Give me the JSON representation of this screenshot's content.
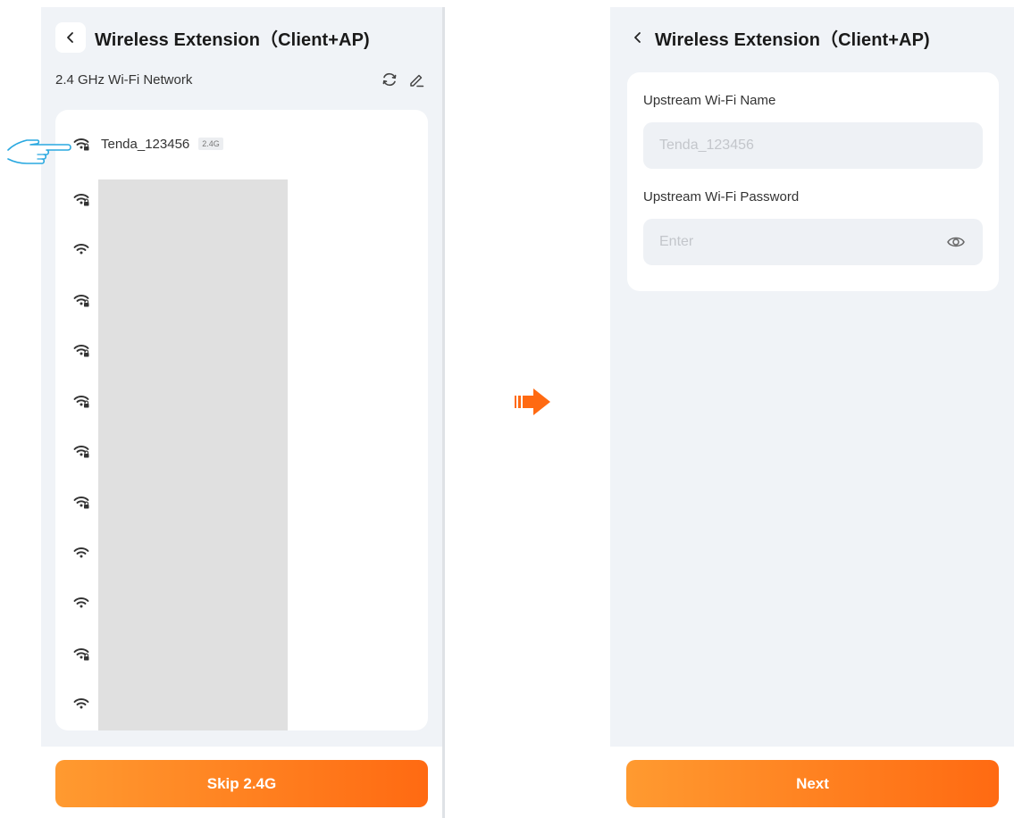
{
  "left_screen": {
    "header": {
      "title": "Wireless Extension（Client+AP)"
    },
    "section_label": "2.4 GHz Wi-Fi Network",
    "networks": [
      {
        "name": "Tenda_123456",
        "band": "2.4G",
        "icon": "wifi-lock-icon"
      },
      {
        "icon": "wifi-lock-icon"
      },
      {
        "icon": "wifi-icon"
      },
      {
        "icon": "wifi-lock-icon"
      },
      {
        "icon": "wifi-lock-icon"
      },
      {
        "icon": "wifi-lock-icon"
      },
      {
        "icon": "wifi-lock-icon"
      },
      {
        "icon": "wifi-lock-icon"
      },
      {
        "icon": "wifi-icon"
      },
      {
        "icon": "wifi-icon"
      },
      {
        "icon": "wifi-lock-icon"
      },
      {
        "icon": "wifi-icon"
      }
    ],
    "skip_button_label": "Skip 2.4G"
  },
  "right_screen": {
    "header": {
      "title": "Wireless Extension（Client+AP)"
    },
    "upstream_name_label": "Upstream Wi-Fi Name",
    "upstream_name_value": "Tenda_123456",
    "upstream_password_label": "Upstream Wi-Fi Password",
    "upstream_password_placeholder": "Enter",
    "next_button_label": "Next"
  },
  "colors": {
    "accent": "#ff7a1a",
    "accent_start": "#ff9a30",
    "accent_end": "#ff6a12",
    "pointer_hand": "#29a8e0",
    "background": "#f0f3f7"
  }
}
